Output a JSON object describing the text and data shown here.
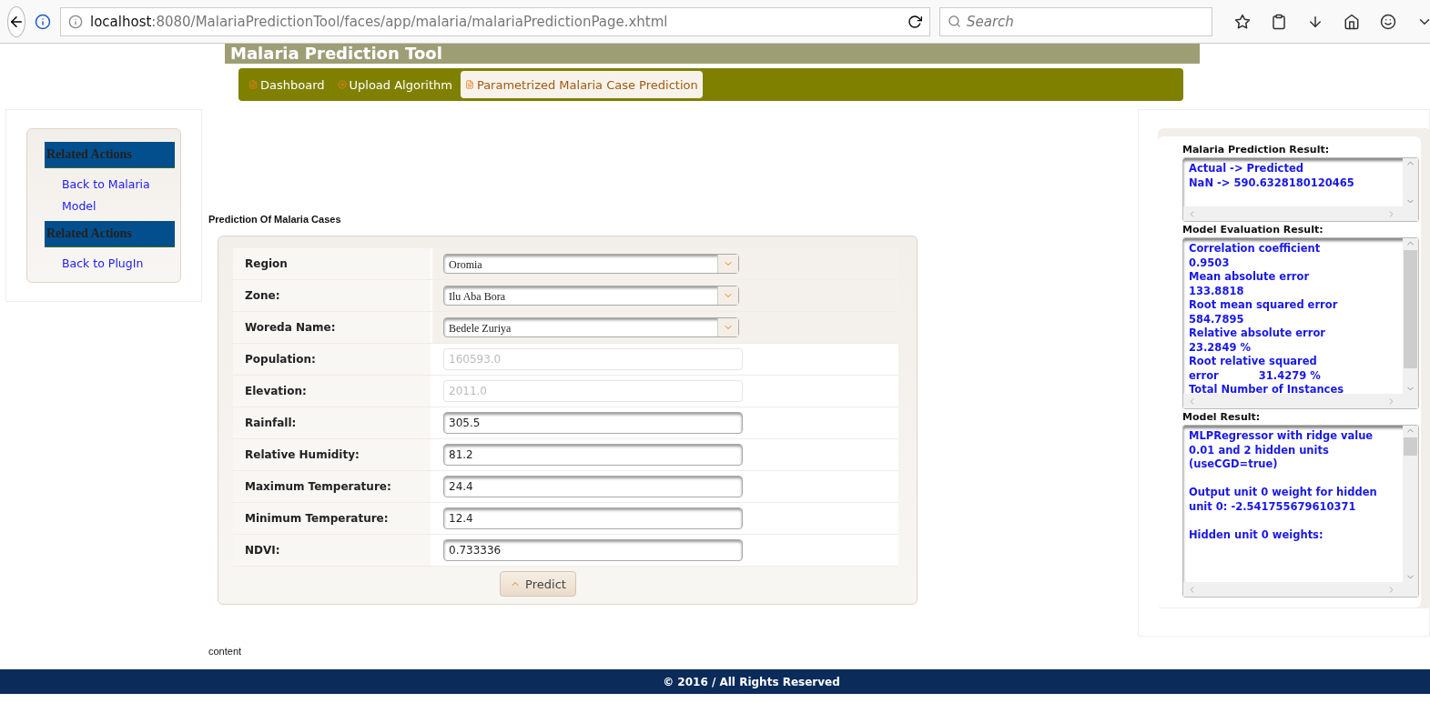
{
  "browser": {
    "url_host": "localhost",
    "url_rest": ":8080/MalariaPredictionTool/faces/app/malaria/malariaPredictionPage.xhtml",
    "search_placeholder": "Search"
  },
  "banner": {
    "title": "Malaria Prediction Tool"
  },
  "nav": [
    {
      "label": "Dashboard",
      "selected": false
    },
    {
      "label": "Upload Algorithm",
      "selected": false
    },
    {
      "label": "Parametrized Malaria Case Prediction",
      "selected": true
    }
  ],
  "sidebar": [
    {
      "heading": "Related Actions",
      "links": [
        "Back to Malaria Model"
      ]
    },
    {
      "heading": "Related Actions",
      "links": [
        "Back to PlugIn"
      ]
    }
  ],
  "form": {
    "title": "Prediction Of Malaria Cases",
    "fields": [
      {
        "label": "Region",
        "kind": "select",
        "value": "Oromia",
        "disabled": false
      },
      {
        "label": "Zone:",
        "kind": "select",
        "value": "Ilu Aba Bora",
        "disabled": false
      },
      {
        "label": "Woreda Name:",
        "kind": "select",
        "value": "Bedele Zuriya",
        "disabled": false
      },
      {
        "label": "Population:",
        "kind": "text",
        "value": "160593.0",
        "disabled": true
      },
      {
        "label": "Elevation:",
        "kind": "text",
        "value": "2011.0",
        "disabled": true
      },
      {
        "label": "Rainfall:",
        "kind": "text",
        "value": "305.5",
        "disabled": false
      },
      {
        "label": "Relative Humidity:",
        "kind": "text",
        "value": "81.2",
        "disabled": false
      },
      {
        "label": "Maximum Temperature:",
        "kind": "text",
        "value": "24.4",
        "disabled": false
      },
      {
        "label": "Minimum Temperature:",
        "kind": "text",
        "value": "12.4",
        "disabled": false
      },
      {
        "label": "NDVI:",
        "kind": "text",
        "value": "0.733336",
        "disabled": false
      }
    ],
    "button": "Predict"
  },
  "results": [
    {
      "label": "Malaria Prediction Result:",
      "text": "Actual -> Predicted\nNaN -> 590.6328180120465"
    },
    {
      "label": "Model Evaluation Result:",
      "text": "Correlation coefficient\n0.9503\nMean absolute error\n133.8818\nRoot mean squared error\n584.7895\nRelative absolute error\n23.2849 %\nRoot relative squared\nerror           31.4279 %\nTotal Number of Instances"
    },
    {
      "label": "Model Result:",
      "text": "MLPRegressor with ridge value\n0.01 and 2 hidden units\n(useCGD=true)\n\nOutput unit 0 weight for hidden\nunit 0: -2.541755679610371\n\nHidden unit 0 weights:"
    }
  ],
  "content_label": "content",
  "footer": "© 2016 / All Rights Reserved"
}
